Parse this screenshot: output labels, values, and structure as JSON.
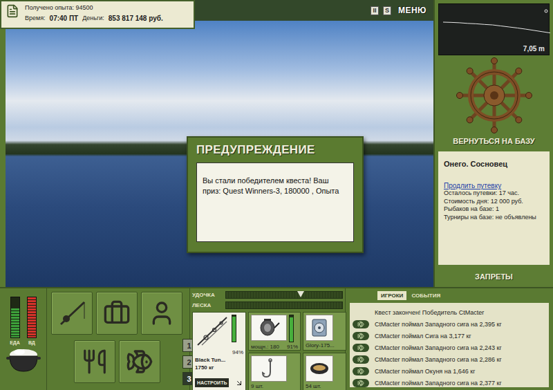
{
  "hud": {
    "experience": "Получено опыта: 94500",
    "time_label": "Время:",
    "time": "07:40 ПТ",
    "money_label": "Деньги:",
    "money": "853 817 148 руб."
  },
  "top_controls": [
    {
      "label": "II"
    },
    {
      "label": "S"
    },
    {
      "label": "МЕНЮ"
    }
  ],
  "depth": {
    "reading": "7,05 m",
    "depths": [
      6.2,
      6.22,
      6.25,
      6.3,
      6.33,
      6.38,
      6.42,
      6.5,
      6.58,
      6.66,
      6.75,
      6.85,
      6.95,
      7.05
    ]
  },
  "base_button": "ВЕРНУТЬСЯ НА БАЗУ",
  "location": {
    "name": "Онего. Сосновец",
    "link": "Продлить путевку",
    "lines": [
      "Осталось путевки: 17 час.",
      "Стоимость дня: 12 000 руб.",
      "Рыбаков на базе: 1",
      "Турниры на базе: не объявлены"
    ]
  },
  "bans_button": "ЗАПРЕТЫ",
  "dialog": {
    "title": "ПРЕДУПРЕЖДЕНИЕ",
    "message": "Вы стали победителем квеста! Ваш приз: Quest Winners-3, 180000 , Опыта"
  },
  "meters": [
    {
      "label": "ЕДА",
      "level": 0.72,
      "color": "#3da23a"
    },
    {
      "label": "ВД",
      "level": 1,
      "color": "#d6322a"
    }
  ],
  "slots": [
    {
      "label": "1",
      "selected": false
    },
    {
      "label": "2",
      "selected": false
    },
    {
      "label": "3",
      "selected": true
    }
  ],
  "tension": [
    {
      "label": "УДОЧКА",
      "level": 0.64
    },
    {
      "label": "ЛЕСКА",
      "level": 0
    }
  ],
  "tackle": {
    "rod": {
      "name": "Black Tun...",
      "weight": "1750 кг",
      "level": 0.94,
      "reading": "94%",
      "button": "НАСТРОИТЬ"
    },
    "reel": {
      "caption": "мощн.: 180",
      "level": 0.91,
      "reading": "91%"
    },
    "line": {
      "caption": "Glory-175..."
    },
    "hook": {
      "caption": "9 шт."
    },
    "bait": {
      "caption": "54 шт."
    }
  },
  "feed": {
    "tabs": [
      {
        "label": "ИГРОКИ",
        "selected": true
      },
      {
        "label": "СОБЫТИЯ",
        "selected": false
      }
    ],
    "messages": [
      {
        "kind": "system",
        "text": "Квест закончен! Победитель CtMacter"
      },
      {
        "kind": "catch",
        "text": "CtMacter поймал Западного сига на 2,395 кг"
      },
      {
        "kind": "catch",
        "text": "CtMacter поймал Сига на 3,177 кг"
      },
      {
        "kind": "catch",
        "text": "CtMacter поймал Западного сига на 2,243 кг"
      },
      {
        "kind": "catch",
        "text": "CtMacter поймал Западного сига на 2,286 кг"
      },
      {
        "kind": "catch",
        "text": "CtMacter поймал Окуня на 1,646 кг"
      },
      {
        "kind": "catch",
        "text": "CtMacter поймал Западного сига на 2,377 кг"
      }
    ]
  }
}
